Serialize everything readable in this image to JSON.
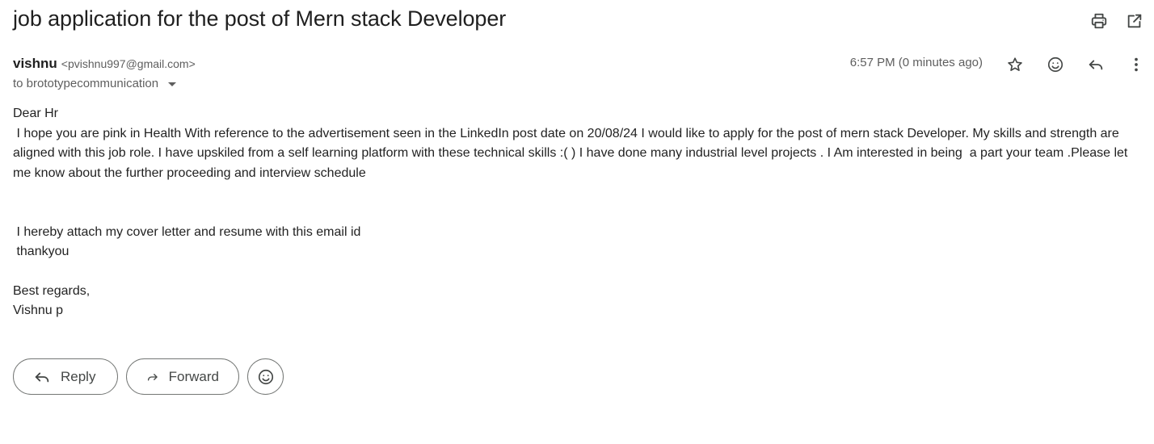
{
  "email": {
    "subject": "job application for the post of Mern stack Developer",
    "sender_name": "vishnu",
    "sender_email": "<pvishnu997@gmail.com>",
    "recipient": "to brototypecommunication",
    "timestamp": "6:57 PM (0 minutes ago)",
    "body": {
      "greeting": "Dear Hr",
      "paragraph": " I hope you are pink in Health With reference to the advertisement seen in the LinkedIn post date on 20/08/24 I would like to apply for the post of mern stack Developer. My skills and strength are aligned with this job role. I have upskiled from a self learning platform with these technical skills :( ) I have done many industrial level projects . I Am interested in being  a part your team .Please let me know about the further proceeding and interview schedule",
      "attach_line": " I hereby attach my cover letter and resume with this email id",
      "thanks": " thankyou",
      "closing": "Best regards,",
      "signature": "Vishnu p"
    }
  },
  "actions": {
    "reply_label": "Reply",
    "forward_label": "Forward"
  },
  "icons": {
    "print": "printer-icon",
    "open_new_window": "open-in-new-icon",
    "star": "star-icon",
    "emoji": "smiley-icon",
    "reply": "reply-icon",
    "more": "more-vert-icon",
    "forward": "forward-icon"
  }
}
